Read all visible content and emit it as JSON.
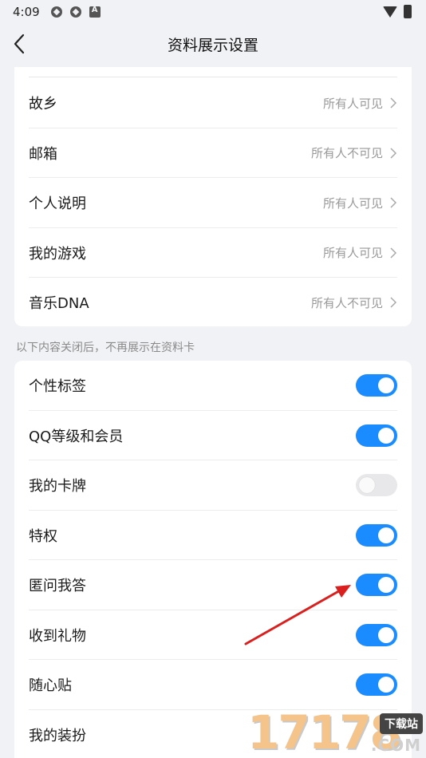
{
  "status_bar": {
    "time": "4:09"
  },
  "header": {
    "title": "资料展示设置"
  },
  "visibility_rows": [
    {
      "label": "故乡",
      "value": "所有人可见"
    },
    {
      "label": "邮箱",
      "value": "所有人不可见"
    },
    {
      "label": "个人说明",
      "value": "所有人可见"
    },
    {
      "label": "我的游戏",
      "value": "所有人可见"
    },
    {
      "label": "音乐DNA",
      "value": "所有人不可见"
    }
  ],
  "section_note": "以下内容关闭后，不再展示在资料卡",
  "toggle_rows": [
    {
      "label": "个性标签",
      "on": true
    },
    {
      "label": "QQ等级和会员",
      "on": true
    },
    {
      "label": "我的卡牌",
      "on": false
    },
    {
      "label": "特权",
      "on": true
    },
    {
      "label": "匿问我答",
      "on": true
    },
    {
      "label": "收到礼物",
      "on": true
    },
    {
      "label": "随心贴",
      "on": true
    },
    {
      "label": "我的装扮"
    }
  ],
  "colors": {
    "accent": "#1a8cff",
    "toggle_off": "#e8e8ea",
    "annotation": "#d9201e"
  },
  "watermark": {
    "digits": "17178",
    "tag": "下载站",
    "suffix": ".COM"
  }
}
